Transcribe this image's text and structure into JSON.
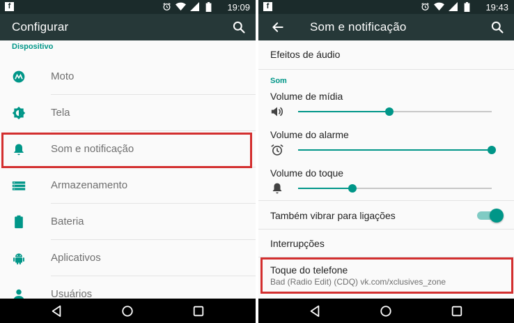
{
  "left": {
    "statusbar": {
      "time": "19:09"
    },
    "toolbar": {
      "title": "Configurar"
    },
    "section": "Dispositivo",
    "items": [
      {
        "label": "Moto",
        "icon": "moto-icon"
      },
      {
        "label": "Tela",
        "icon": "brightness-icon"
      },
      {
        "label": "Som e notificação",
        "icon": "bell-icon"
      },
      {
        "label": "Armazenamento",
        "icon": "storage-icon"
      },
      {
        "label": "Bateria",
        "icon": "battery-icon"
      },
      {
        "label": "Aplicativos",
        "icon": "android-icon"
      },
      {
        "label": "Usuários",
        "icon": "person-icon"
      }
    ]
  },
  "right": {
    "statusbar": {
      "time": "19:43"
    },
    "toolbar": {
      "title": "Som e notificação"
    },
    "audio_effects": "Efeitos de áudio",
    "section": "Som",
    "volumes": [
      {
        "label": "Volume de mídia",
        "icon": "speaker-icon",
        "level": 0.47
      },
      {
        "label": "Volume do alarme",
        "icon": "alarm-icon",
        "level": 1.0
      },
      {
        "label": "Volume do toque",
        "icon": "bell-icon",
        "level": 0.28
      }
    ],
    "vibrate_label": "Também vibrar para ligações",
    "vibrate_on": true,
    "interruptions": "Interrupções",
    "ringtone": {
      "label": "Toque do telefone",
      "value": "Bad (Radio Edit) (CDQ) vk.com/xclusives_zone"
    }
  },
  "colors": {
    "accent": "#009688",
    "highlight": "#d32f2f",
    "toolbar": "#263838",
    "statusbar": "#1b2b2b"
  }
}
